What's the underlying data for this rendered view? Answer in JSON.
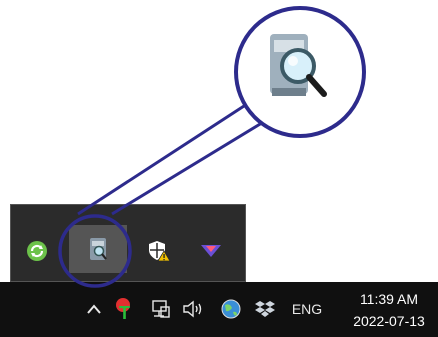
{
  "taskbar": {
    "language": "ENG",
    "time": "11:39 AM",
    "date": "2022-07-13"
  },
  "tray_popup": {
    "icons": [
      "sync-icon",
      "scanner-app-icon",
      "security-warning-icon",
      "check-chevron-icon"
    ],
    "selected": "scanner-app-icon"
  },
  "callout": {
    "icon": "scanner-magnifier-icon",
    "accent_color": "#2d2b8c"
  },
  "colors": {
    "taskbar_bg": "#101010",
    "popup_bg": "#2b2b2b",
    "highlight_ring": "#2d2b8c"
  }
}
